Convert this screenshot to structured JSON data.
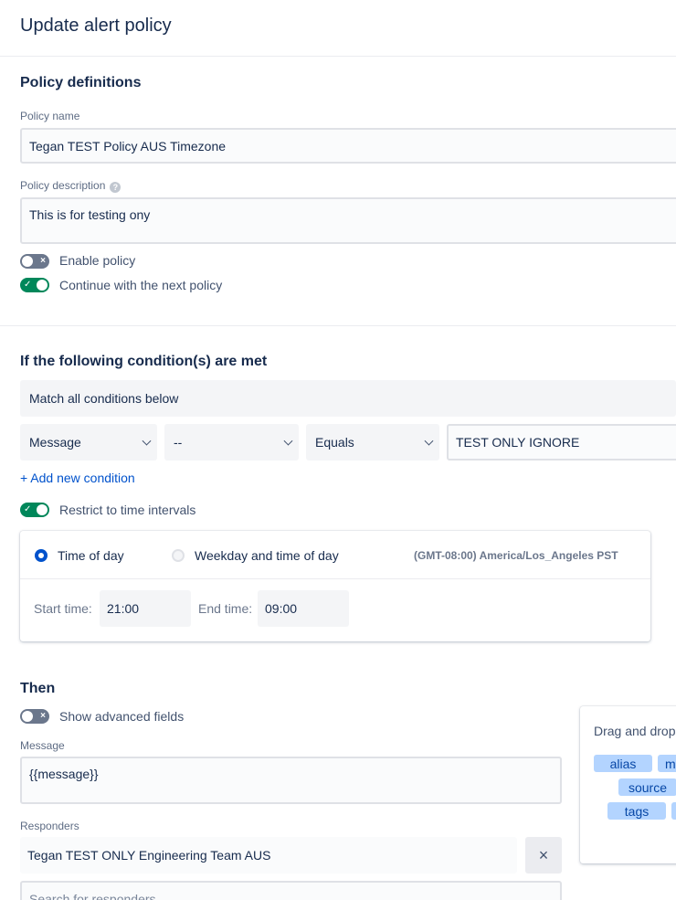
{
  "page": {
    "title": "Update alert policy"
  },
  "definitions": {
    "section_title": "Policy definitions",
    "policy_name_label": "Policy name",
    "policy_name_value": "Tegan TEST Policy AUS Timezone",
    "policy_description_label": "Policy description",
    "help_icon": "?",
    "policy_description_value": "This is for testing ony",
    "enable_policy": {
      "label": "Enable policy",
      "on": false,
      "icon": "×"
    },
    "continue_next": {
      "label": "Continue with the next policy",
      "on": true,
      "icon": "✓"
    }
  },
  "conditions": {
    "section_title": "If the following condition(s) are met",
    "match_mode": "Match all conditions below",
    "row": {
      "field": "Message",
      "operator_not": "--",
      "operator": "Equals",
      "value": "TEST ONLY IGNORE"
    },
    "add_condition_label": "+ Add new condition",
    "restrict_time": {
      "label": "Restrict to time intervals",
      "on": true,
      "icon": "✓"
    },
    "time_card": {
      "option_time_of_day": "Time of day",
      "option_weekday": "Weekday and time of day",
      "selected": "Time of day",
      "timezone": "(GMT-08:00) America/Los_Angeles PST",
      "start_label": "Start time:",
      "start_value": "21:00",
      "end_label": "End time:",
      "end_value": "09:00"
    }
  },
  "then": {
    "section_title": "Then",
    "advanced_fields": {
      "label": "Show advanced fields",
      "on": false,
      "icon": "×"
    },
    "message_label": "Message",
    "message_value": "{{message}}",
    "responders_label": "Responders",
    "responder_value": "Tegan TEST ONLY Engineering Team AUS",
    "clear_icon": "×",
    "responders_search_placeholder": "Search for responders"
  },
  "drag_panel": {
    "title": "Drag and drop",
    "chips": [
      "alias",
      "m",
      "source",
      "tags",
      ""
    ]
  },
  "colors": {
    "accent": "#0052cc",
    "toggle_on": "#00875a",
    "toggle_off": "#6b778c",
    "chip_bg": "#b3d4ff"
  }
}
